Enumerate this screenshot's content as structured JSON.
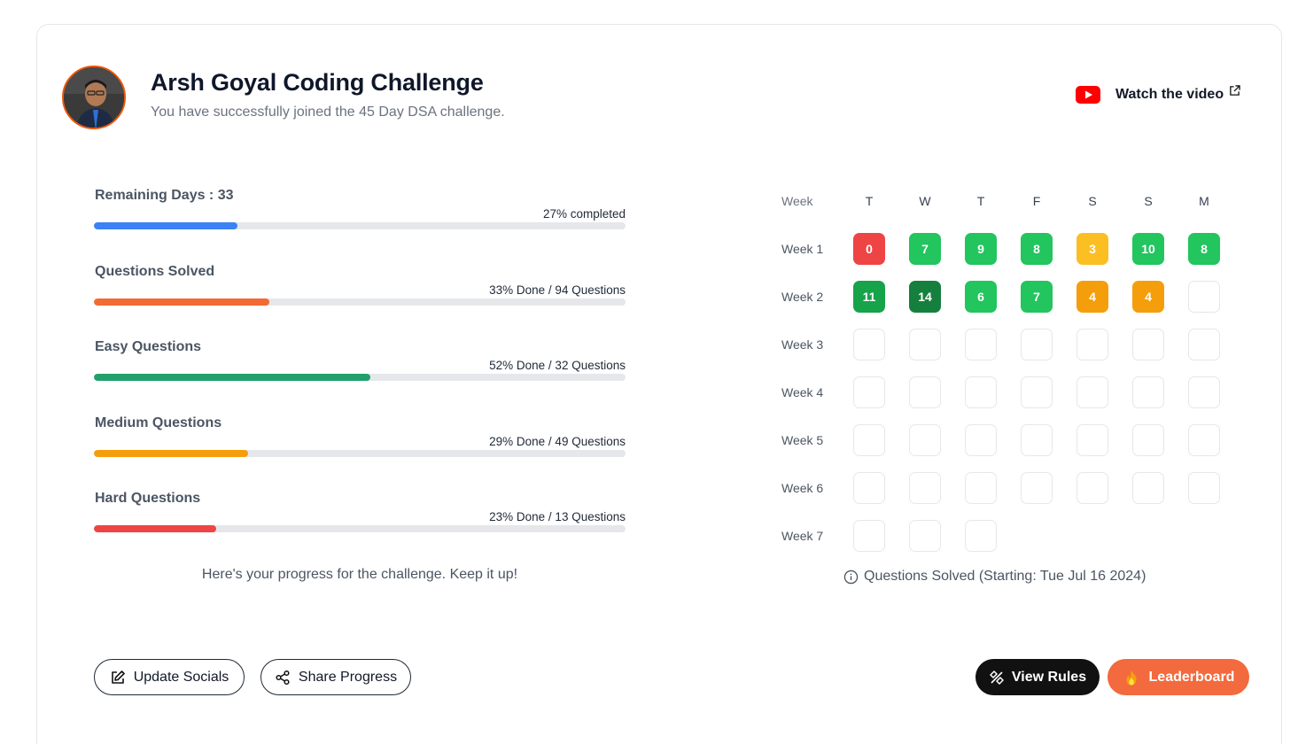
{
  "header": {
    "title": "Arsh Goyal Coding Challenge",
    "subtitle": "You have successfully joined the 45 Day DSA challenge.",
    "avatar_icon": "profile-photo",
    "watch_label": "Watch the video",
    "watch_icon": "youtube-icon",
    "external_icon": "external-link-icon"
  },
  "progress": {
    "metrics": [
      {
        "label": "Remaining Days : 33",
        "status": "27% completed",
        "percent": 27,
        "color": "#3b82f6"
      },
      {
        "label": "Questions Solved",
        "status": "33% Done / 94 Questions",
        "percent": 33,
        "color": "#f26b35"
      },
      {
        "label": "Easy Questions",
        "status": "52% Done / 32 Questions",
        "percent": 52,
        "color": "#22a06b"
      },
      {
        "label": "Medium Questions",
        "status": "29% Done / 49 Questions",
        "percent": 29,
        "color": "#f59e0b"
      },
      {
        "label": "Hard Questions",
        "status": "23% Done / 13 Questions",
        "percent": 23,
        "color": "#ef4444"
      }
    ],
    "note": "Here's your progress for the challenge. Keep it up!"
  },
  "calendar": {
    "week_header": "Week",
    "days": [
      "T",
      "W",
      "T",
      "F",
      "S",
      "S",
      "M"
    ],
    "weeks": [
      {
        "label": "Week 1",
        "cells": [
          {
            "value": "0",
            "color": "#ef4444"
          },
          {
            "value": "7",
            "color": "#22c55e"
          },
          {
            "value": "9",
            "color": "#22c55e"
          },
          {
            "value": "8",
            "color": "#22c55e"
          },
          {
            "value": "3",
            "color": "#fbbf24"
          },
          {
            "value": "10",
            "color": "#22c55e"
          },
          {
            "value": "8",
            "color": "#22c55e"
          }
        ]
      },
      {
        "label": "Week 2",
        "cells": [
          {
            "value": "11",
            "color": "#16a34a"
          },
          {
            "value": "14",
            "color": "#15803d"
          },
          {
            "value": "6",
            "color": "#22c55e"
          },
          {
            "value": "7",
            "color": "#22c55e"
          },
          {
            "value": "4",
            "color": "#f59e0b"
          },
          {
            "value": "4",
            "color": "#f59e0b"
          },
          {
            "value": "",
            "color": ""
          }
        ]
      },
      {
        "label": "Week 3",
        "cells": [
          {
            "value": ""
          },
          {
            "value": ""
          },
          {
            "value": ""
          },
          {
            "value": ""
          },
          {
            "value": ""
          },
          {
            "value": ""
          },
          {
            "value": ""
          }
        ]
      },
      {
        "label": "Week 4",
        "cells": [
          {
            "value": ""
          },
          {
            "value": ""
          },
          {
            "value": ""
          },
          {
            "value": ""
          },
          {
            "value": ""
          },
          {
            "value": ""
          },
          {
            "value": ""
          }
        ]
      },
      {
        "label": "Week 5",
        "cells": [
          {
            "value": ""
          },
          {
            "value": ""
          },
          {
            "value": ""
          },
          {
            "value": ""
          },
          {
            "value": ""
          },
          {
            "value": ""
          },
          {
            "value": ""
          }
        ]
      },
      {
        "label": "Week 6",
        "cells": [
          {
            "value": ""
          },
          {
            "value": ""
          },
          {
            "value": ""
          },
          {
            "value": ""
          },
          {
            "value": ""
          },
          {
            "value": ""
          },
          {
            "value": ""
          }
        ]
      },
      {
        "label": "Week 7",
        "cells": [
          {
            "value": ""
          },
          {
            "value": ""
          },
          {
            "value": ""
          }
        ]
      }
    ],
    "note": "Questions Solved (Starting: Tue Jul 16 2024)",
    "note_icon": "info-icon"
  },
  "actions": {
    "update_socials": "Update Socials",
    "share_progress": "Share Progress",
    "view_rules": "View Rules",
    "leaderboard": "Leaderboard"
  }
}
